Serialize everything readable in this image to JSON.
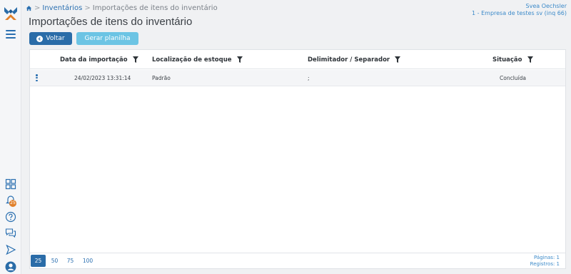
{
  "breadcrumb": {
    "home_icon": "home-icon",
    "link": "Inventários",
    "current": "Importações de itens do inventário"
  },
  "user": {
    "name": "Svea Oechsler",
    "company": "1 - Empresa de testes sv (inq 66)"
  },
  "page": {
    "title": "Importações de itens do inventário"
  },
  "toolbar": {
    "back_label": "Voltar",
    "sheet_label": "Gerar planilha"
  },
  "sidebar": {
    "notification_count": "25",
    "icons": [
      "logo-icon",
      "menu-icon",
      "dashboard-icon",
      "bell-icon",
      "help-icon",
      "chat-icon",
      "send-icon",
      "user-avatar-icon"
    ]
  },
  "table": {
    "columns": [
      "Data da importação",
      "Localização de estoque",
      "Delimitador / Separador",
      "Situação"
    ],
    "rows": [
      [
        "24/02/2023 13:31:14",
        "Padrão",
        ";",
        "Concluída"
      ]
    ]
  },
  "pagination": {
    "sizes": [
      "25",
      "50",
      "75",
      "100"
    ],
    "active": "25",
    "pages_label": "Páginas: 1",
    "records_label": "Registros: 1"
  },
  "colors": {
    "primary": "#2a6ca8",
    "secondary_button": "#6cc4e4",
    "badge": "#e1802a",
    "link": "#2a6fb0"
  }
}
